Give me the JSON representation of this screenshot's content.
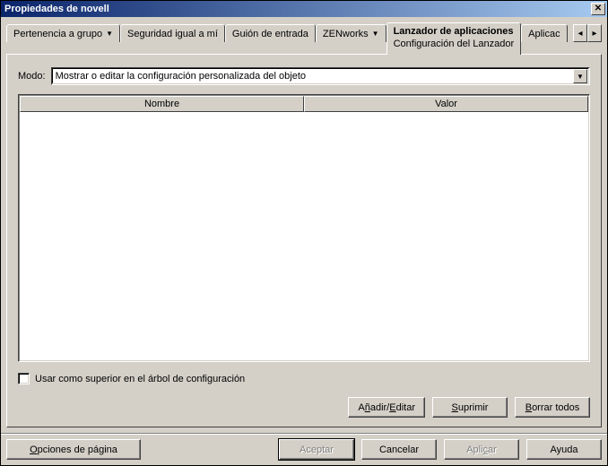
{
  "window": {
    "title": "Propiedades de novell"
  },
  "tabs": {
    "items": [
      {
        "label": "Pertenencia a grupo",
        "dropdown": true
      },
      {
        "label": "Seguridad igual a mí",
        "dropdown": false
      },
      {
        "label": "Guión de entrada",
        "dropdown": false
      },
      {
        "label": "ZENworks",
        "dropdown": true
      },
      {
        "label": "Lanzador de aplicaciones",
        "sub": "Configuración del Lanzador",
        "active": true
      },
      {
        "label": "Aplicac",
        "dropdown": false
      }
    ]
  },
  "mode": {
    "label": "Modo:",
    "value": "Mostrar o editar la configuración personalizada del objeto"
  },
  "table": {
    "cols": [
      "Nombre",
      "Valor"
    ]
  },
  "checkbox": {
    "label": "Usar como superior en el árbol de configuración"
  },
  "panel_buttons": {
    "add_edit_pre": "A",
    "add_edit_u": "ñ",
    "add_edit_post": "adir/",
    "add_edit_u2": "E",
    "add_edit_post2": "ditar",
    "delete_pre": "",
    "delete_u": "S",
    "delete_post": "uprimir",
    "clear_pre": "",
    "clear_u": "B",
    "clear_post": "orrar todos"
  },
  "bottom": {
    "page_options_pre": "",
    "page_options_u": "O",
    "page_options_post": "pciones de página",
    "ok": "Aceptar",
    "cancel": "Cancelar",
    "apply_pre": "Apli",
    "apply_u": "c",
    "apply_post": "ar",
    "help": "Ayuda"
  }
}
